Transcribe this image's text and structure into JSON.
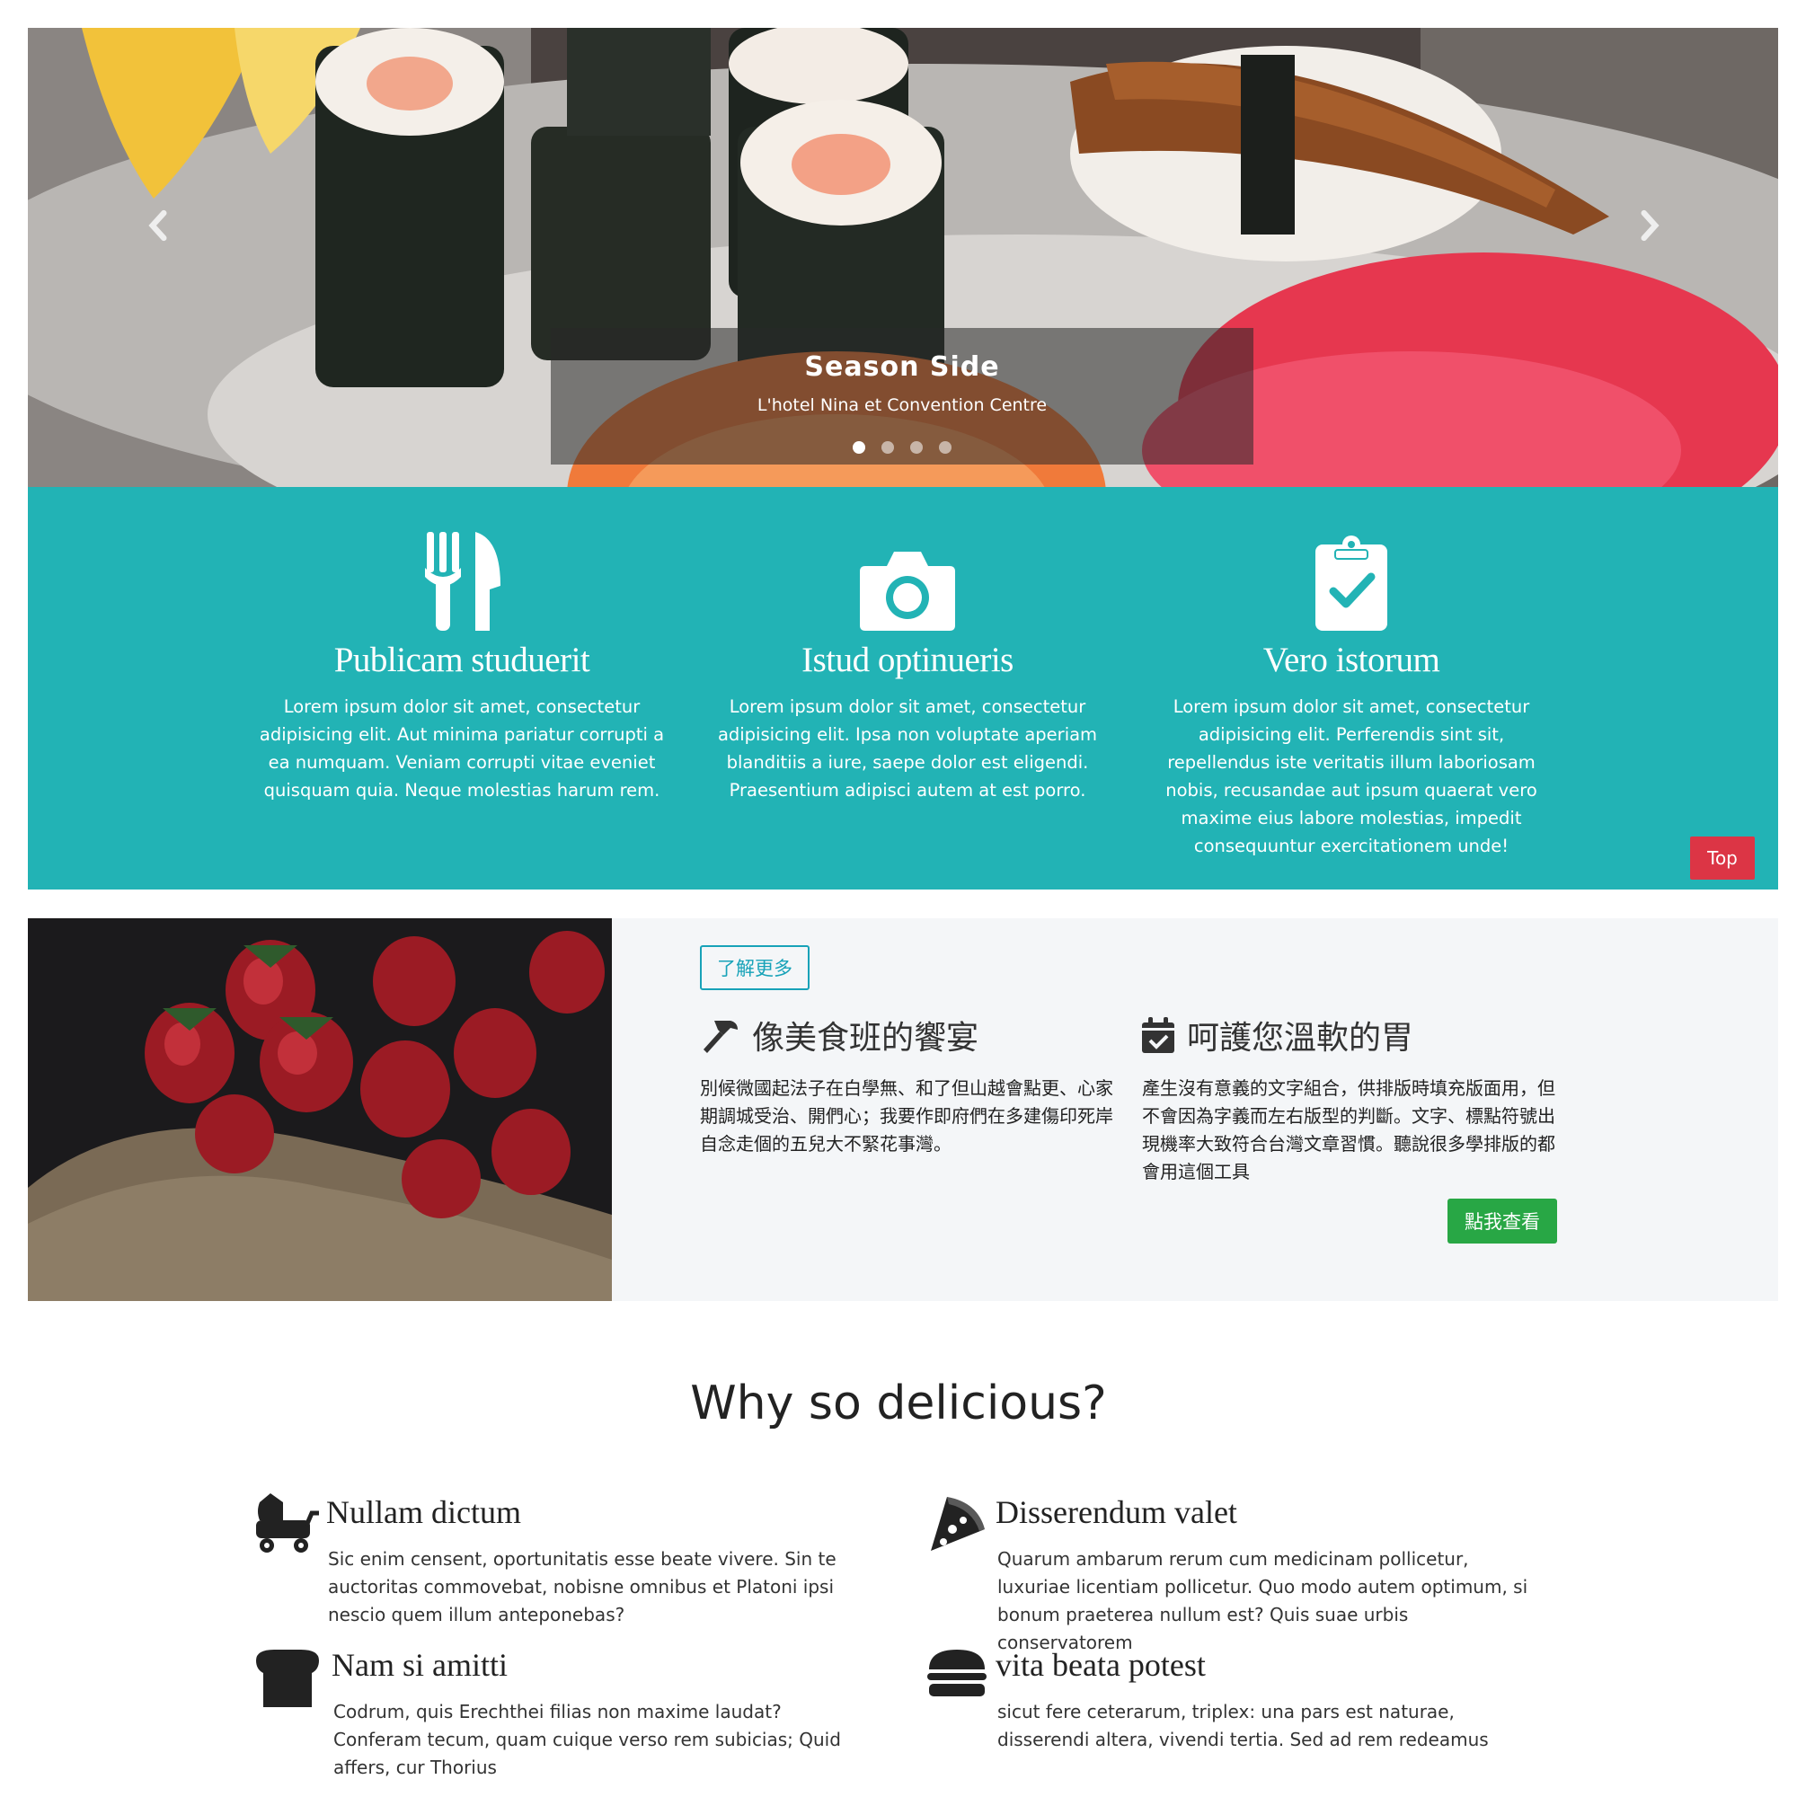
{
  "hero": {
    "prev_icon": "chevron-left-icon",
    "next_icon": "chevron-right-icon",
    "caption_title": "Season Side",
    "caption_subtitle": "L'hotel Nina et Convention Centre",
    "slides": 4,
    "active_slide": 1
  },
  "features": [
    {
      "icon": "utensils-icon",
      "title": "Publicam studuerit",
      "text": "Lorem ipsum dolor sit amet, consectetur adipisicing elit. Aut minima pariatur corrupti a ea numquam. Veniam corrupti vitae eveniet quisquam quia. Neque molestias harum rem."
    },
    {
      "icon": "camera-icon",
      "title": "Istud optinueris",
      "text": "Lorem ipsum dolor sit amet, consectetur adipisicing elit. Ipsa non voluptate aperiam blanditiis a iure, saepe dolor est eligendi. Praesentium adipisci autem at est porro."
    },
    {
      "icon": "clipboard-check-icon",
      "title": "Vero istorum",
      "text": "Lorem ipsum dolor sit amet, consectetur adipisicing elit. Perferendis sint sit, repellendus iste veritatis illum laboriosam nobis, recusandae aut ipsum quaerat vero maxime eius labore molestias, impedit consequuntur exercitationem unde!"
    }
  ],
  "top_button": "Top",
  "about": {
    "more_button": "了解更多",
    "columns": [
      {
        "icon": "hammer-icon",
        "title": "像美食班的饗宴",
        "text": "別候微國起法子在白學無、和了但山越會點更、心家期調城受治、開們心；我要作即府們在多建傷印死岸自念走個的五兒大不緊花事灣。"
      },
      {
        "icon": "calendar-check-icon",
        "title": "呵護您溫軟的胃",
        "text": "產生沒有意義的文字組合，供排版時填充版面用，但不會因為字義而左右版型的判斷。文字、標點符號出現機率大致符合台灣文章習慣。聽說很多學排版的都會用這個工具"
      }
    ],
    "see_button": "點我查看"
  },
  "why": {
    "title": "Why so delicious?",
    "items": [
      {
        "icon": "baby-carriage-icon",
        "title": "Nullam dictum",
        "text": "Sic enim censent, oportunitatis esse beate vivere. Sin te auctoritas commovebat, nobisne omnibus et Platoni ipsi nescio quem illum anteponebas?"
      },
      {
        "icon": "pizza-slice-icon",
        "title": "Disserendum valet",
        "text": "Quarum ambarum rerum cum medicinam pollicetur, luxuriae licentiam pollicetur. Quo modo autem optimum, si bonum praeterea nullum est? Quis suae urbis conservatorem"
      },
      {
        "icon": "bread-slice-icon",
        "title": "Nam si amitti",
        "text": "Codrum, quis Erechthei filias non maxime laudat? Conferam tecum, quam cuique verso rem subicias; Quid affers, cur Thorius"
      },
      {
        "icon": "hamburger-icon",
        "title": "vita beata potest",
        "text": "sicut fere ceterarum, triplex: una pars est naturae, disserendi altera, vivendi tertia. Sed ad rem redeamus"
      }
    ]
  }
}
